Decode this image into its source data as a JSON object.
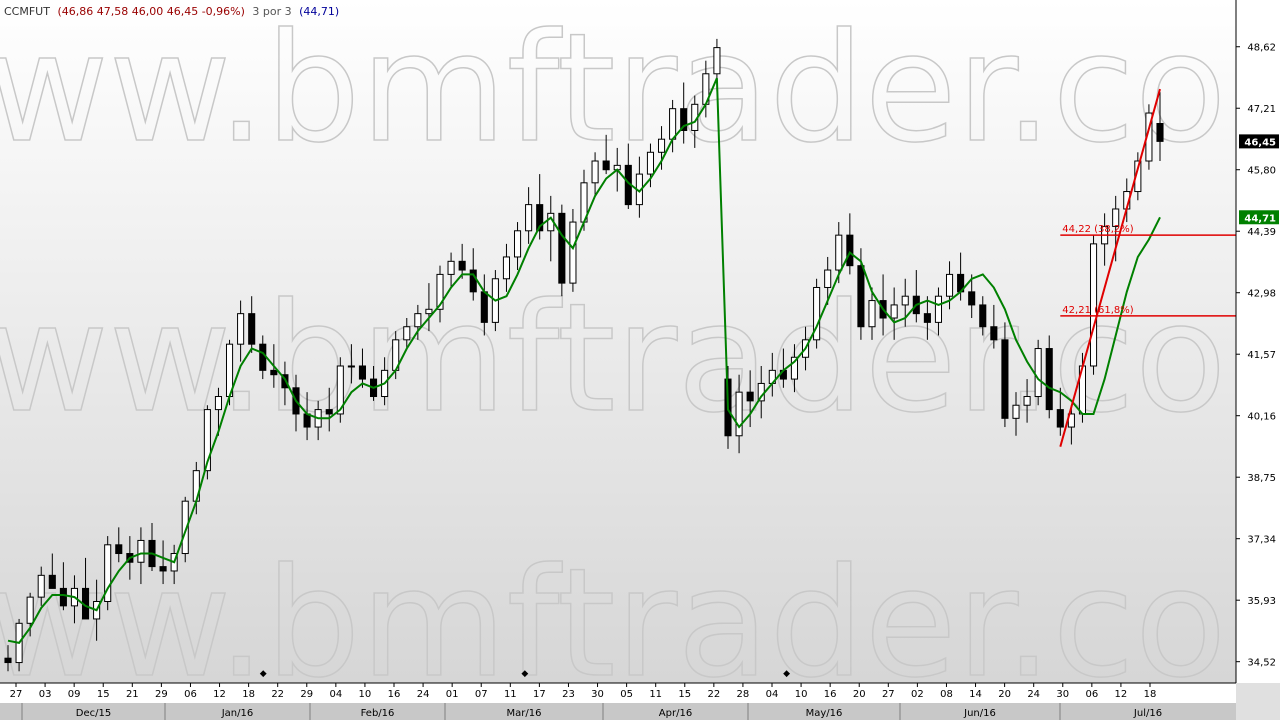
{
  "header": {
    "symbol": "CCMFUT",
    "ohlc_text": "(46,86  47,58  46,00  46,45  -0,96%)",
    "indicator_label": "3 por 3",
    "indicator_value_text": "(44,71)"
  },
  "watermark": "www.bmftrader.com",
  "colors": {
    "ohlc": "#990000",
    "indicator": "#000099",
    "ma_line": "#008000",
    "fib": "#e00000",
    "candle_edge": "#000000",
    "bg_top": "#ffffff",
    "bg_bottom": "#d9d9d9"
  },
  "chart_data": {
    "type": "candlestick",
    "ylim": [
      34.1,
      49.6
    ],
    "y_ticks": [
      "48,62",
      "47,21",
      "45,80",
      "44,39",
      "42,98",
      "41,57",
      "40,16",
      "38,75",
      "37,34",
      "35,93",
      "34,52"
    ],
    "y_tick_values": [
      48.62,
      47.21,
      45.8,
      44.39,
      42.98,
      41.57,
      40.16,
      38.75,
      37.34,
      35.93,
      34.52
    ],
    "day_ticks": [
      "27",
      "03",
      "09",
      "15",
      "21",
      "29",
      "06",
      "12",
      "18",
      "22",
      "29",
      "04",
      "10",
      "16",
      "24",
      "01",
      "07",
      "11",
      "17",
      "23",
      "30",
      "05",
      "11",
      "15",
      "22",
      "28",
      "04",
      "10",
      "16",
      "20",
      "27",
      "02",
      "08",
      "14",
      "20",
      "24",
      "30",
      "06",
      "12",
      "18"
    ],
    "month_labels": [
      "Dec/15",
      "Jan/16",
      "Feb/16",
      "Mar/16",
      "Apr/16",
      "May/16",
      "Jun/16",
      "Jul/16"
    ],
    "last_price_label": "46,45",
    "ma_value_label": "44,71",
    "candles": [
      [
        34.6,
        34.9,
        34.3,
        34.5
      ],
      [
        34.5,
        35.5,
        34.3,
        35.4
      ],
      [
        35.4,
        36.1,
        35.1,
        36.0
      ],
      [
        36.0,
        36.7,
        35.8,
        36.5
      ],
      [
        36.5,
        37.0,
        36.2,
        36.2
      ],
      [
        36.2,
        36.8,
        35.7,
        35.8
      ],
      [
        35.8,
        36.5,
        35.4,
        36.2
      ],
      [
        36.2,
        36.9,
        35.8,
        35.5
      ],
      [
        35.5,
        36.4,
        35.0,
        35.9
      ],
      [
        35.9,
        37.4,
        35.7,
        37.2
      ],
      [
        37.2,
        37.6,
        36.8,
        37.0
      ],
      [
        37.0,
        37.4,
        36.4,
        36.8
      ],
      [
        36.8,
        37.6,
        36.3,
        37.3
      ],
      [
        37.3,
        37.7,
        36.6,
        36.7
      ],
      [
        36.7,
        37.3,
        36.3,
        36.6
      ],
      [
        36.6,
        37.2,
        36.3,
        37.0
      ],
      [
        37.0,
        38.3,
        36.8,
        38.2
      ],
      [
        38.2,
        39.1,
        37.9,
        38.9
      ],
      [
        38.9,
        40.4,
        38.7,
        40.3
      ],
      [
        40.3,
        40.8,
        39.7,
        40.6
      ],
      [
        40.6,
        41.9,
        40.4,
        41.8
      ],
      [
        41.8,
        42.8,
        41.4,
        42.5
      ],
      [
        42.5,
        42.9,
        41.6,
        41.8
      ],
      [
        41.8,
        42.0,
        41.0,
        41.2
      ],
      [
        41.2,
        41.8,
        40.8,
        41.1
      ],
      [
        41.1,
        41.4,
        40.4,
        40.8
      ],
      [
        40.8,
        41.1,
        39.8,
        40.2
      ],
      [
        40.2,
        40.7,
        39.6,
        39.9
      ],
      [
        39.9,
        40.5,
        39.6,
        40.3
      ],
      [
        40.3,
        40.8,
        39.8,
        40.2
      ],
      [
        40.2,
        41.5,
        40.0,
        41.3
      ],
      [
        41.3,
        41.8,
        40.9,
        41.3
      ],
      [
        41.3,
        41.7,
        40.8,
        41.0
      ],
      [
        41.0,
        41.3,
        40.5,
        40.6
      ],
      [
        40.6,
        41.5,
        40.4,
        41.2
      ],
      [
        41.2,
        42.1,
        41.0,
        41.9
      ],
      [
        41.9,
        42.4,
        41.7,
        42.2
      ],
      [
        42.2,
        42.7,
        41.9,
        42.5
      ],
      [
        42.5,
        43.2,
        42.1,
        42.6
      ],
      [
        42.6,
        43.6,
        42.3,
        43.4
      ],
      [
        43.4,
        43.9,
        43.1,
        43.7
      ],
      [
        43.7,
        44.1,
        43.3,
        43.5
      ],
      [
        43.5,
        44.0,
        42.8,
        43.0
      ],
      [
        43.0,
        43.4,
        42.0,
        42.3
      ],
      [
        42.3,
        43.5,
        42.1,
        43.3
      ],
      [
        43.3,
        44.1,
        43.0,
        43.8
      ],
      [
        43.8,
        44.6,
        43.5,
        44.4
      ],
      [
        44.4,
        45.4,
        44.1,
        45.0
      ],
      [
        45.0,
        45.7,
        44.2,
        44.4
      ],
      [
        44.4,
        45.2,
        43.7,
        44.8
      ],
      [
        44.8,
        45.0,
        42.9,
        43.2
      ],
      [
        43.2,
        44.9,
        43.0,
        44.6
      ],
      [
        44.6,
        45.8,
        44.4,
        45.5
      ],
      [
        45.5,
        46.2,
        45.2,
        46.0
      ],
      [
        46.0,
        46.6,
        45.7,
        45.8
      ],
      [
        45.8,
        46.3,
        45.3,
        45.9
      ],
      [
        45.9,
        46.4,
        44.9,
        45.0
      ],
      [
        45.0,
        46.1,
        44.7,
        45.7
      ],
      [
        45.7,
        46.4,
        45.4,
        46.2
      ],
      [
        46.2,
        46.8,
        45.8,
        46.5
      ],
      [
        46.5,
        47.4,
        46.2,
        47.2
      ],
      [
        47.2,
        47.8,
        46.4,
        46.7
      ],
      [
        46.7,
        47.5,
        46.3,
        47.3
      ],
      [
        47.3,
        48.3,
        47.0,
        48.0
      ],
      [
        48.0,
        48.8,
        47.6,
        48.6
      ],
      [
        41.0,
        41.3,
        39.4,
        39.7
      ],
      [
        39.7,
        41.1,
        39.3,
        40.7
      ],
      [
        40.7,
        41.2,
        39.9,
        40.5
      ],
      [
        40.5,
        41.3,
        40.1,
        40.9
      ],
      [
        40.9,
        41.6,
        40.6,
        41.2
      ],
      [
        41.2,
        41.7,
        40.8,
        41.0
      ],
      [
        41.0,
        41.8,
        40.7,
        41.5
      ],
      [
        41.5,
        42.2,
        41.2,
        41.9
      ],
      [
        41.9,
        43.3,
        41.7,
        43.1
      ],
      [
        43.1,
        43.8,
        42.7,
        43.5
      ],
      [
        43.5,
        44.6,
        43.2,
        44.3
      ],
      [
        44.3,
        44.8,
        43.4,
        43.6
      ],
      [
        43.6,
        44.0,
        41.9,
        42.2
      ],
      [
        42.2,
        43.1,
        41.9,
        42.8
      ],
      [
        42.8,
        43.4,
        42.0,
        42.4
      ],
      [
        42.4,
        43.1,
        41.9,
        42.7
      ],
      [
        42.7,
        43.3,
        42.2,
        42.9
      ],
      [
        42.9,
        43.5,
        42.3,
        42.5
      ],
      [
        42.5,
        42.9,
        41.9,
        42.3
      ],
      [
        42.3,
        43.1,
        42.0,
        42.9
      ],
      [
        42.9,
        43.7,
        42.6,
        43.4
      ],
      [
        43.4,
        43.9,
        42.8,
        43.0
      ],
      [
        43.0,
        43.4,
        42.4,
        42.7
      ],
      [
        42.7,
        42.9,
        42.0,
        42.2
      ],
      [
        42.2,
        42.7,
        41.7,
        41.9
      ],
      [
        41.9,
        42.3,
        39.9,
        40.1
      ],
      [
        40.1,
        40.7,
        39.7,
        40.4
      ],
      [
        40.4,
        41.0,
        40.0,
        40.6
      ],
      [
        40.6,
        41.9,
        40.4,
        41.7
      ],
      [
        41.7,
        42.0,
        40.1,
        40.3
      ],
      [
        40.3,
        40.8,
        39.7,
        39.9
      ],
      [
        39.9,
        40.4,
        39.5,
        40.2
      ],
      [
        40.2,
        41.6,
        40.0,
        41.3
      ],
      [
        41.3,
        44.3,
        41.1,
        44.1
      ],
      [
        44.1,
        44.8,
        43.6,
        44.5
      ],
      [
        44.5,
        45.2,
        43.7,
        44.9
      ],
      [
        44.9,
        45.6,
        44.6,
        45.3
      ],
      [
        45.3,
        46.2,
        45.1,
        46.0
      ],
      [
        46.0,
        47.3,
        45.8,
        47.1
      ],
      [
        46.86,
        47.58,
        46.0,
        46.45
      ]
    ],
    "gap_after_index": 64,
    "ma": [
      35.0,
      34.95,
      35.3,
      35.75,
      36.05,
      36.05,
      36.0,
      35.8,
      35.7,
      36.2,
      36.6,
      36.9,
      37.0,
      37.0,
      36.9,
      36.8,
      37.5,
      38.2,
      39.1,
      39.8,
      40.6,
      41.3,
      41.7,
      41.6,
      41.3,
      41.0,
      40.5,
      40.2,
      40.1,
      40.1,
      40.3,
      40.7,
      40.9,
      40.8,
      40.9,
      41.2,
      41.7,
      42.1,
      42.4,
      42.7,
      43.1,
      43.4,
      43.4,
      43.0,
      42.8,
      42.9,
      43.4,
      44.0,
      44.5,
      44.7,
      44.3,
      44.0,
      44.6,
      45.2,
      45.6,
      45.8,
      45.5,
      45.3,
      45.6,
      46.0,
      46.5,
      46.8,
      46.9,
      47.3,
      47.9,
      40.3,
      39.9,
      40.2,
      40.6,
      40.9,
      41.2,
      41.4,
      41.7,
      42.2,
      42.8,
      43.4,
      43.9,
      43.7,
      43.0,
      42.6,
      42.3,
      42.4,
      42.7,
      42.8,
      42.7,
      42.8,
      43.0,
      43.3,
      43.4,
      43.1,
      42.6,
      41.9,
      41.4,
      41.0,
      40.8,
      40.7,
      40.5,
      40.2,
      40.2,
      41.0,
      42.0,
      43.0,
      43.8,
      44.2,
      44.71
    ],
    "fib_trend": {
      "from_index": 95,
      "from_price": 39.45,
      "to_index": 104,
      "to_price": 47.65
    },
    "fib_levels": [
      {
        "label": "44,22 (38,2%)",
        "price": 44.3
      },
      {
        "label": "42,21 (61,8%)",
        "price": 42.45
      }
    ],
    "markers": [
      {
        "label": "◆",
        "index": 8
      },
      {
        "label": "◆",
        "index": 17
      },
      {
        "label": "◆",
        "index": 26
      }
    ]
  }
}
